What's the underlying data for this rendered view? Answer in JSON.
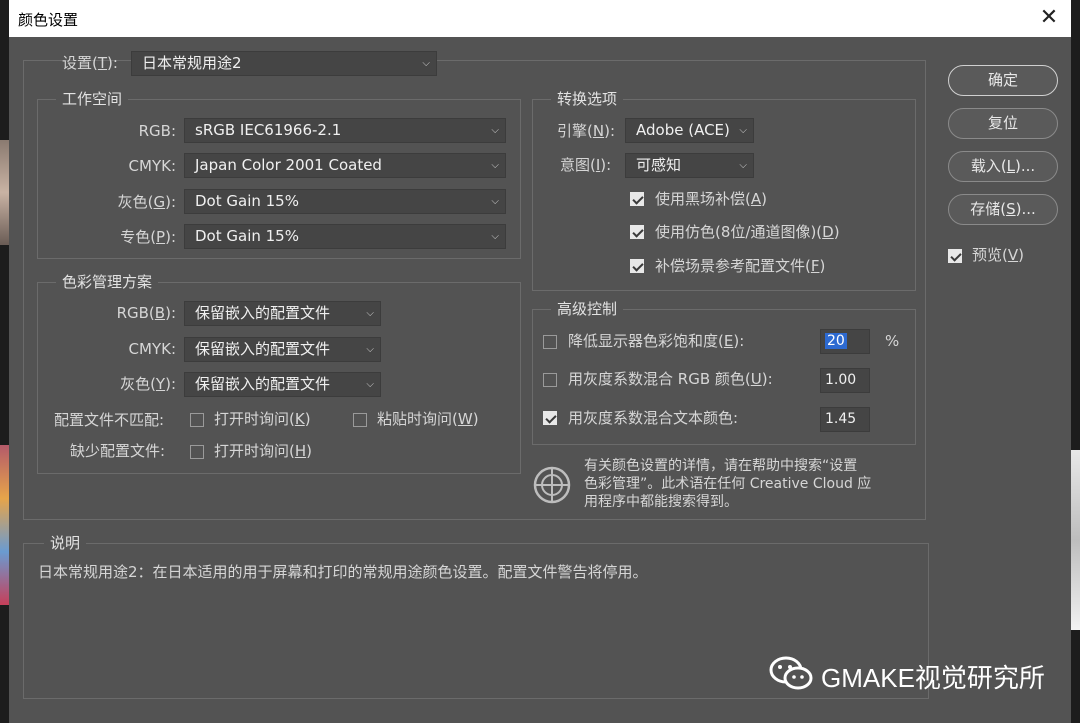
{
  "dialog": {
    "title": "颜色设置",
    "close_glyph": "✕"
  },
  "settings": {
    "label": "设置(",
    "key": "T",
    "label_end": "):",
    "value": "日本常规用途2"
  },
  "workspace": {
    "title": "工作空间",
    "rgb": {
      "label": "RGB:",
      "value": "sRGB IEC61966-2.1"
    },
    "cmyk": {
      "label": "CMYK:",
      "value": "Japan Color 2001 Coated"
    },
    "gray": {
      "label": "灰色(",
      "key": "G",
      "label_end": "):",
      "value": "Dot Gain 15%"
    },
    "spot": {
      "label": "专色(",
      "key": "P",
      "label_end": "):",
      "value": "Dot Gain 15%"
    }
  },
  "policies": {
    "title": "色彩管理方案",
    "rgb": {
      "label": "RGB(",
      "key": "B",
      "label_end": "):",
      "value": "保留嵌入的配置文件"
    },
    "cmyk": {
      "label": "CMYK:",
      "value": "保留嵌入的配置文件"
    },
    "gray": {
      "label": "灰色(",
      "key": "Y",
      "label_end": "):",
      "value": "保留嵌入的配置文件"
    },
    "mismatch_label": "配置文件不匹配:",
    "ask_open": {
      "label": "打开时询问(",
      "key": "K",
      "label_end": ")"
    },
    "ask_paste": {
      "label": "粘贴时询问(",
      "key": "W",
      "label_end": ")"
    },
    "missing_label": "缺少配置文件:",
    "missing_ask_open": {
      "label": "打开时询问(",
      "key": "H",
      "label_end": ")"
    }
  },
  "conversion": {
    "title": "转换选项",
    "engine": {
      "label": "引擎(",
      "key": "N",
      "label_end": "):",
      "value": "Adobe (ACE)"
    },
    "intent": {
      "label": "意图(",
      "key": "I",
      "label_end": "):",
      "value": "可感知"
    },
    "black_point": {
      "label": "使用黑场补偿(",
      "key": "A",
      "label_end": ")",
      "checked": true
    },
    "dither": {
      "label": "使用仿色(8位/通道图像)(",
      "key": "D",
      "label_end": ")",
      "checked": true
    },
    "compensate": {
      "label": "补偿场景参考配置文件(",
      "key": "F",
      "label_end": ")",
      "checked": true
    }
  },
  "advanced": {
    "title": "高级控制",
    "desaturate": {
      "label": "降低显示器色彩饱和度(",
      "key": "E",
      "label_end": "):",
      "value": "20",
      "unit": "%",
      "checked": false
    },
    "blend_rgb": {
      "label": "用灰度系数混合 RGB 颜色(",
      "key": "U",
      "label_end": "):",
      "value": "1.00",
      "checked": false
    },
    "blend_text": {
      "label": "用灰度系数混合文本颜色:",
      "value": "1.45",
      "checked": true
    }
  },
  "info": {
    "line1": "有关颜色设置的详情，请在帮助中搜索“设置",
    "line2": "色彩管理”。此术语在任何 Creative Cloud 应",
    "line3": "用程序中都能搜索得到。"
  },
  "description": {
    "title": "说明",
    "text": "日本常规用途2：在日本适用的用于屏幕和打印的常规用途颜色设置。配置文件警告将停用。"
  },
  "buttons": {
    "ok": "确定",
    "reset": "复位",
    "load": "载入(",
    "load_key": "L",
    "load_end": ")...",
    "save": "存储(",
    "save_key": "S",
    "save_end": ")..."
  },
  "preview": {
    "label": "预览(",
    "key": "V",
    "label_end": ")",
    "checked": true
  },
  "watermark": {
    "text": "GMAKE视觉研究所"
  },
  "colors": {
    "dialog_bg": "#535353",
    "accent": "#2d6ad1"
  }
}
